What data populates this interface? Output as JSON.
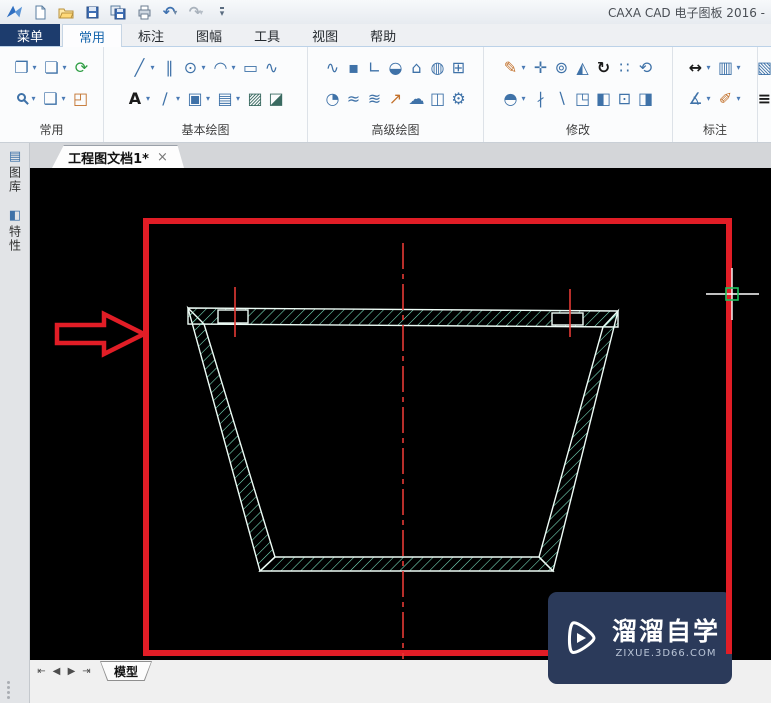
{
  "window": {
    "title": "CAXA CAD 电子图板 2016 -"
  },
  "icons": {
    "caret": "▾",
    "undo": "↶",
    "redo": "↷",
    "close": "×",
    "magnifier": "css-circle-with-handle"
  },
  "menu_tabs": [
    {
      "label": "菜单"
    },
    {
      "label": "常用"
    },
    {
      "label": "标注"
    },
    {
      "label": "图幅"
    },
    {
      "label": "工具"
    },
    {
      "label": "视图"
    },
    {
      "label": "帮助"
    }
  ],
  "ribbon": {
    "g1": {
      "label": "常用",
      "r1": [
        "❐",
        "❏",
        "⟳"
      ],
      "r2": [
        "❑",
        "◰"
      ]
    },
    "g2": {
      "label": "基本绘图",
      "r1": [
        "╱",
        "∥",
        "⊙",
        "◠",
        "▭",
        "∿"
      ],
      "r2": [
        "A",
        "∕",
        "▣",
        "▤",
        "▨",
        "◪"
      ]
    },
    "g3": {
      "label": "高级绘图",
      "r1": [
        "∿",
        "▪",
        "∟",
        "◒",
        "⌂",
        "◍",
        "⊞"
      ],
      "r2": [
        "◔",
        "≈",
        "≋",
        "↗",
        "☁",
        "◫",
        "⚙"
      ]
    },
    "g4": {
      "label": "修改",
      "r1": [
        "✎",
        "✛",
        "⊚",
        "◭",
        "↻",
        "∷",
        "⟲"
      ],
      "r2": [
        "◓",
        "∤",
        "∖",
        "◳",
        "◧",
        "⊡",
        "◨"
      ]
    },
    "g5": {
      "label": "标注",
      "r1": [
        "↔",
        "▥"
      ],
      "r2": [
        "∡",
        "✐"
      ]
    },
    "g6": {
      "partial": [
        "▧",
        "≡"
      ]
    }
  },
  "document_tab": {
    "label": "工程图文档1*"
  },
  "side_tabs": [
    {
      "label": "图库",
      "glyph": "▤"
    },
    {
      "label": "特性",
      "glyph": "◧"
    }
  ],
  "sheet_bar": {
    "nav": [
      "⇤",
      "◀",
      "▶",
      "⇥"
    ],
    "tab": "模型"
  },
  "watermark": {
    "title": "溜溜自学",
    "site": "ZIXUE.3D66.COM"
  },
  "colors": {
    "highlight_red": "#e11d26",
    "centerline_red": "#e53935",
    "hatch_cyan": "#7fe9c6",
    "outline_white": "#eefcf6",
    "crosshair_green": "#1fc25f",
    "watermark_bg": "#2b3a5a",
    "menu_dark_blue": "#1d3c6d",
    "active_tab_blue": "#1766ad"
  }
}
